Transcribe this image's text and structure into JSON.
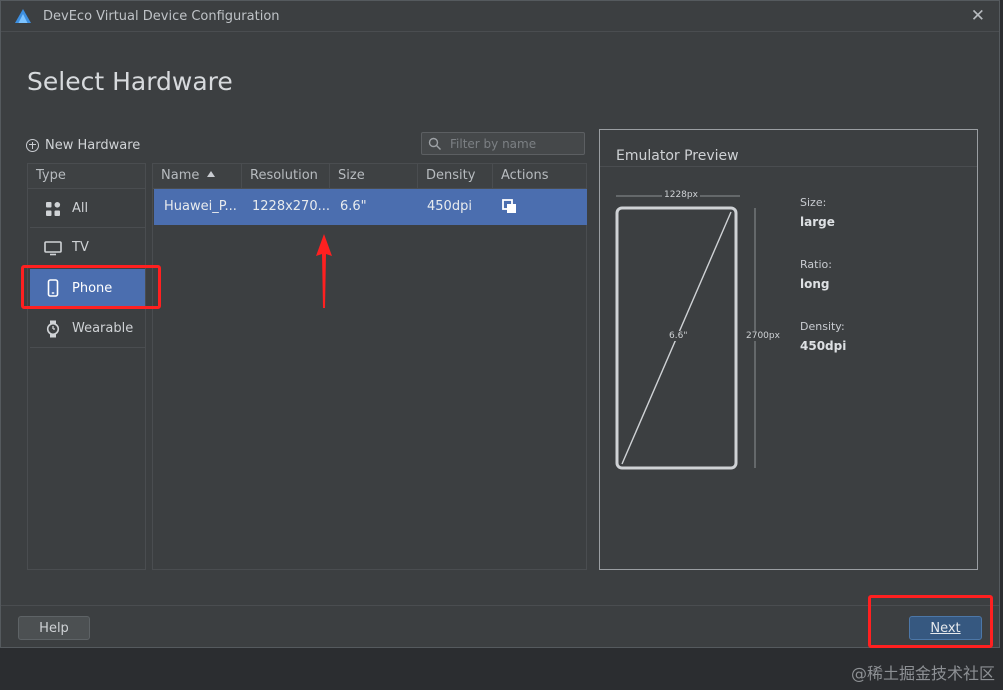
{
  "window": {
    "title": "DevEco Virtual Device Configuration",
    "close_symbol": "✕"
  },
  "page": {
    "title": "Select Hardware"
  },
  "toolbar": {
    "new_hardware_label": "New Hardware",
    "filter_placeholder": "Filter by name"
  },
  "type_panel": {
    "header": "Type",
    "items": [
      {
        "label": "All",
        "icon": "grid-icon",
        "selected": false
      },
      {
        "label": "TV",
        "icon": "tv-icon",
        "selected": false
      },
      {
        "label": "Phone",
        "icon": "phone-icon",
        "selected": true
      },
      {
        "label": "Wearable",
        "icon": "watch-icon",
        "selected": false
      }
    ]
  },
  "table": {
    "columns": [
      "Name",
      "Resolution",
      "Size",
      "Density",
      "Actions"
    ],
    "sort_column": "Name",
    "rows": [
      {
        "name": "Huawei_P...",
        "resolution": "1228x270...",
        "size": "6.6\"",
        "density": "450dpi",
        "action_icon": "copy-icon",
        "selected": true
      }
    ]
  },
  "preview": {
    "title": "Emulator Preview",
    "width_label": "1228px",
    "height_label": "2700px",
    "diagonal_label": "6.6\"",
    "specs": [
      {
        "label": "Size:",
        "value": "large"
      },
      {
        "label": "Ratio:",
        "value": "long"
      },
      {
        "label": "Density:",
        "value": "450dpi"
      }
    ]
  },
  "footer": {
    "help_label": "Help",
    "next_label": "Next"
  },
  "watermark": "@稀土掘金技术社区",
  "colors": {
    "selection": "#4b6eaf",
    "annotation": "#ff2020",
    "primary_button": "#365880"
  }
}
